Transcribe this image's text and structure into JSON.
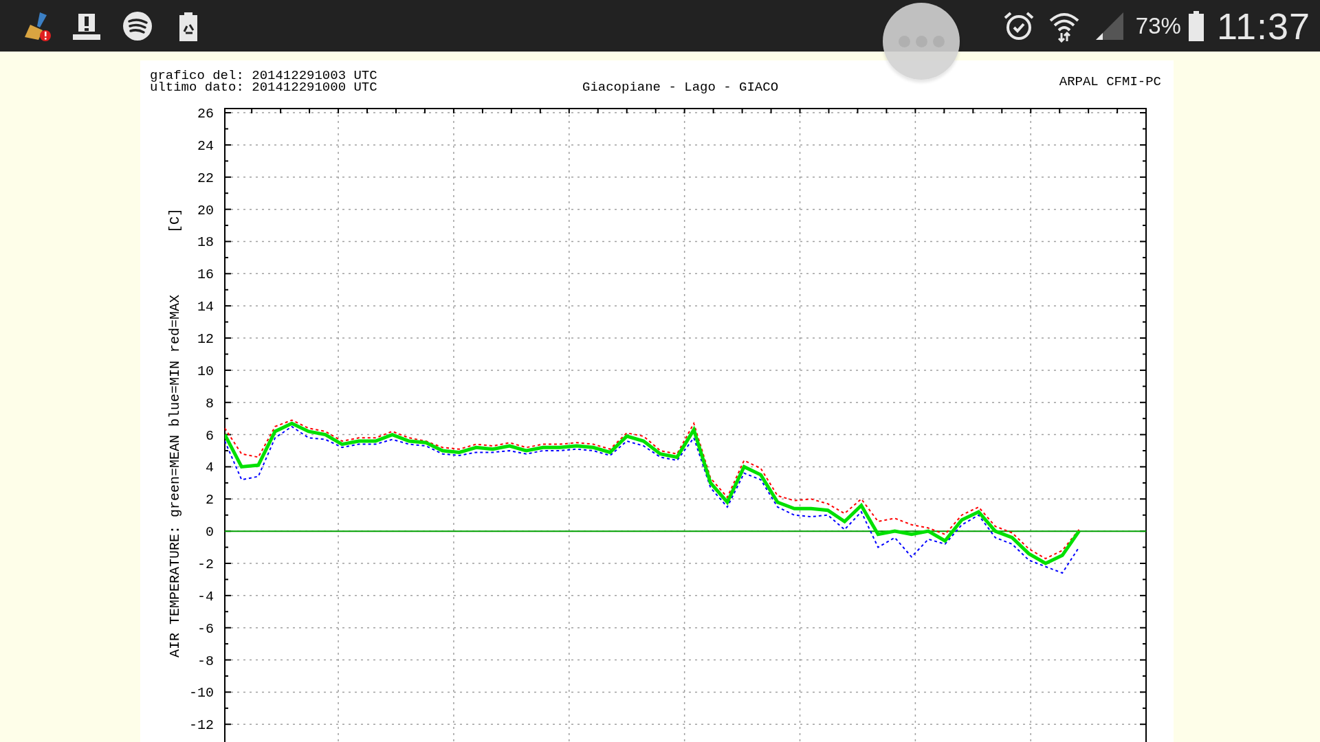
{
  "status_bar": {
    "battery": "73%",
    "time": "11:37"
  },
  "chart": {
    "header_left": [
      "grafico del: 201412291003 UTC",
      "ultimo dato: 201412291000 UTC"
    ],
    "title": "Giacopiane - Lago - GIACO",
    "source": "ARPAL CFMI-PC",
    "unit_label": "[C]",
    "chart_data": {
      "type": "line",
      "ylabel": "AIR TEMPERATURE: green=MEAN  blue=MIN  red=MAX",
      "categories": [
        null,
        null,
        null,
        null,
        null,
        null,
        null,
        null,
        null,
        null,
        null,
        null,
        null,
        null,
        null,
        null,
        null,
        null,
        null,
        null,
        null,
        null,
        null,
        null,
        null,
        null,
        null,
        null,
        null,
        null,
        null,
        null,
        null,
        null,
        null,
        null,
        null,
        null,
        null,
        null,
        null,
        null,
        null,
        null,
        null,
        null,
        null,
        null,
        null,
        null,
        null,
        null
      ],
      "series": [
        {
          "color": "#ff0000",
          "line_style": "dashed",
          "values": [
            6.4,
            4.8,
            4.6,
            6.5,
            6.9,
            6.4,
            6.2,
            5.6,
            5.8,
            5.8,
            6.2,
            5.8,
            5.6,
            5.2,
            5.1,
            5.4,
            5.3,
            5.5,
            5.2,
            5.4,
            5.4,
            5.5,
            5.4,
            5.1,
            6.1,
            5.9,
            5.0,
            4.8,
            6.7,
            3.3,
            2.1,
            4.4,
            3.9,
            2.2,
            1.9,
            2.0,
            1.7,
            1.1,
            2.0,
            0.6,
            0.8,
            0.4,
            0.2,
            -0.2,
            1.0,
            1.5,
            0.3,
            -0.1,
            -1.1,
            -1.7,
            -1.2,
            0.1
          ]
        },
        {
          "color": "#0000ff",
          "line_style": "dashed",
          "values": [
            5.6,
            3.2,
            3.4,
            5.8,
            6.5,
            5.8,
            5.7,
            5.2,
            5.4,
            5.4,
            5.7,
            5.4,
            5.3,
            4.8,
            4.7,
            4.9,
            4.9,
            5.0,
            4.8,
            5.0,
            5.0,
            5.1,
            5.0,
            4.7,
            5.6,
            5.3,
            4.6,
            4.4,
            5.8,
            2.7,
            1.5,
            3.6,
            3.2,
            1.5,
            1.0,
            0.9,
            1.0,
            0.1,
            1.2,
            -1.0,
            -0.4,
            -1.6,
            -0.5,
            -0.8,
            0.4,
            1.0,
            -0.4,
            -0.8,
            -1.8,
            -2.2,
            -2.6,
            -1.0
          ]
        },
        {
          "color": "#00e000",
          "line_style": "solid",
          "values": [
            6.0,
            4.0,
            4.1,
            6.2,
            6.7,
            6.2,
            6.0,
            5.4,
            5.6,
            5.6,
            6.0,
            5.6,
            5.5,
            5.0,
            4.9,
            5.2,
            5.1,
            5.3,
            5.0,
            5.2,
            5.2,
            5.3,
            5.2,
            4.9,
            5.9,
            5.6,
            4.8,
            4.6,
            6.3,
            3.0,
            1.8,
            4.0,
            3.5,
            1.8,
            1.4,
            1.4,
            1.3,
            0.6,
            1.6,
            -0.2,
            0.0,
            -0.2,
            0.0,
            -0.6,
            0.7,
            1.2,
            0.0,
            -0.4,
            -1.4,
            -2.0,
            -1.5,
            0.0
          ]
        }
      ],
      "ylim": [
        -13.1,
        26.26
      ],
      "grid": true,
      "yticks": [
        -12,
        -10,
        -8,
        -6,
        -4,
        -2,
        0,
        2,
        4,
        6,
        8,
        10,
        12,
        14,
        16,
        18,
        20,
        22,
        24,
        26
      ],
      "ref_lines": [
        {
          "axis": "y",
          "value": 0
        }
      ]
    }
  }
}
